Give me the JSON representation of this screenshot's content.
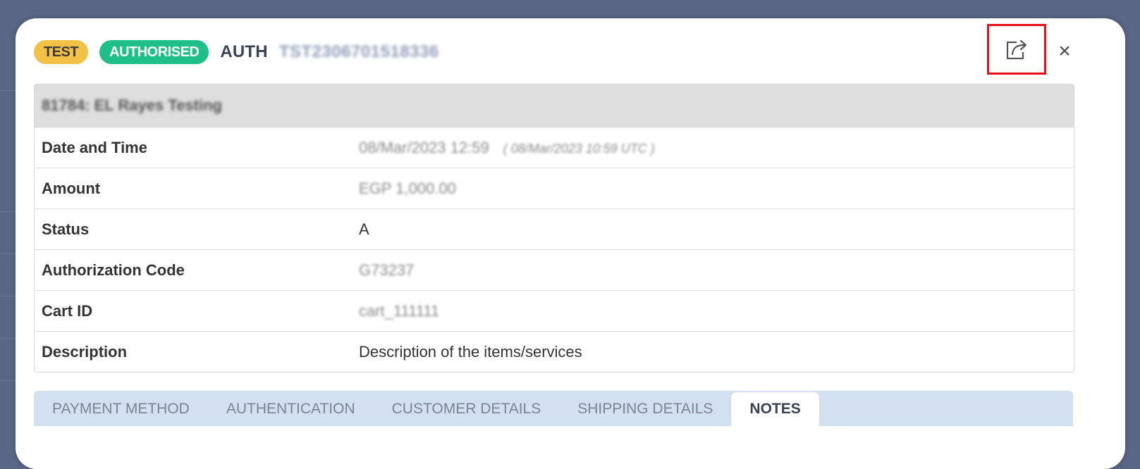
{
  "header": {
    "badges": {
      "test": "TEST",
      "status": "AUTHORISED"
    },
    "type_label": "AUTH",
    "reference": "TST2306701518336"
  },
  "actions": {
    "share_icon": "share-external-icon",
    "close_icon": "close-icon",
    "close_glyph": "×",
    "highlight_color": "#e6101c"
  },
  "details": {
    "merchant": "81784: EL Rayes Testing",
    "rows": [
      {
        "label": "Date and Time",
        "value": "08/Mar/2023 12:59",
        "extra": "( 08/Mar/2023 10:59 UTC )"
      },
      {
        "label": "Amount",
        "value": "EGP 1,000.00"
      },
      {
        "label": "Status",
        "value": "A"
      },
      {
        "label": "Authorization Code",
        "value": "G73237"
      },
      {
        "label": "Cart ID",
        "value": "cart_111111"
      },
      {
        "label": "Description",
        "value": "Description of the items/services"
      }
    ]
  },
  "tabs": [
    {
      "label": "PAYMENT METHOD"
    },
    {
      "label": "AUTHENTICATION"
    },
    {
      "label": "CUSTOMER DETAILS"
    },
    {
      "label": "SHIPPING DETAILS"
    },
    {
      "label": "NOTES"
    }
  ],
  "active_tab": "NOTES",
  "colors": {
    "badge_test": "#f2c145",
    "badge_authorised": "#1fbf8a",
    "backdrop": "#5a6686",
    "tab_bar": "#d2e0f2"
  }
}
